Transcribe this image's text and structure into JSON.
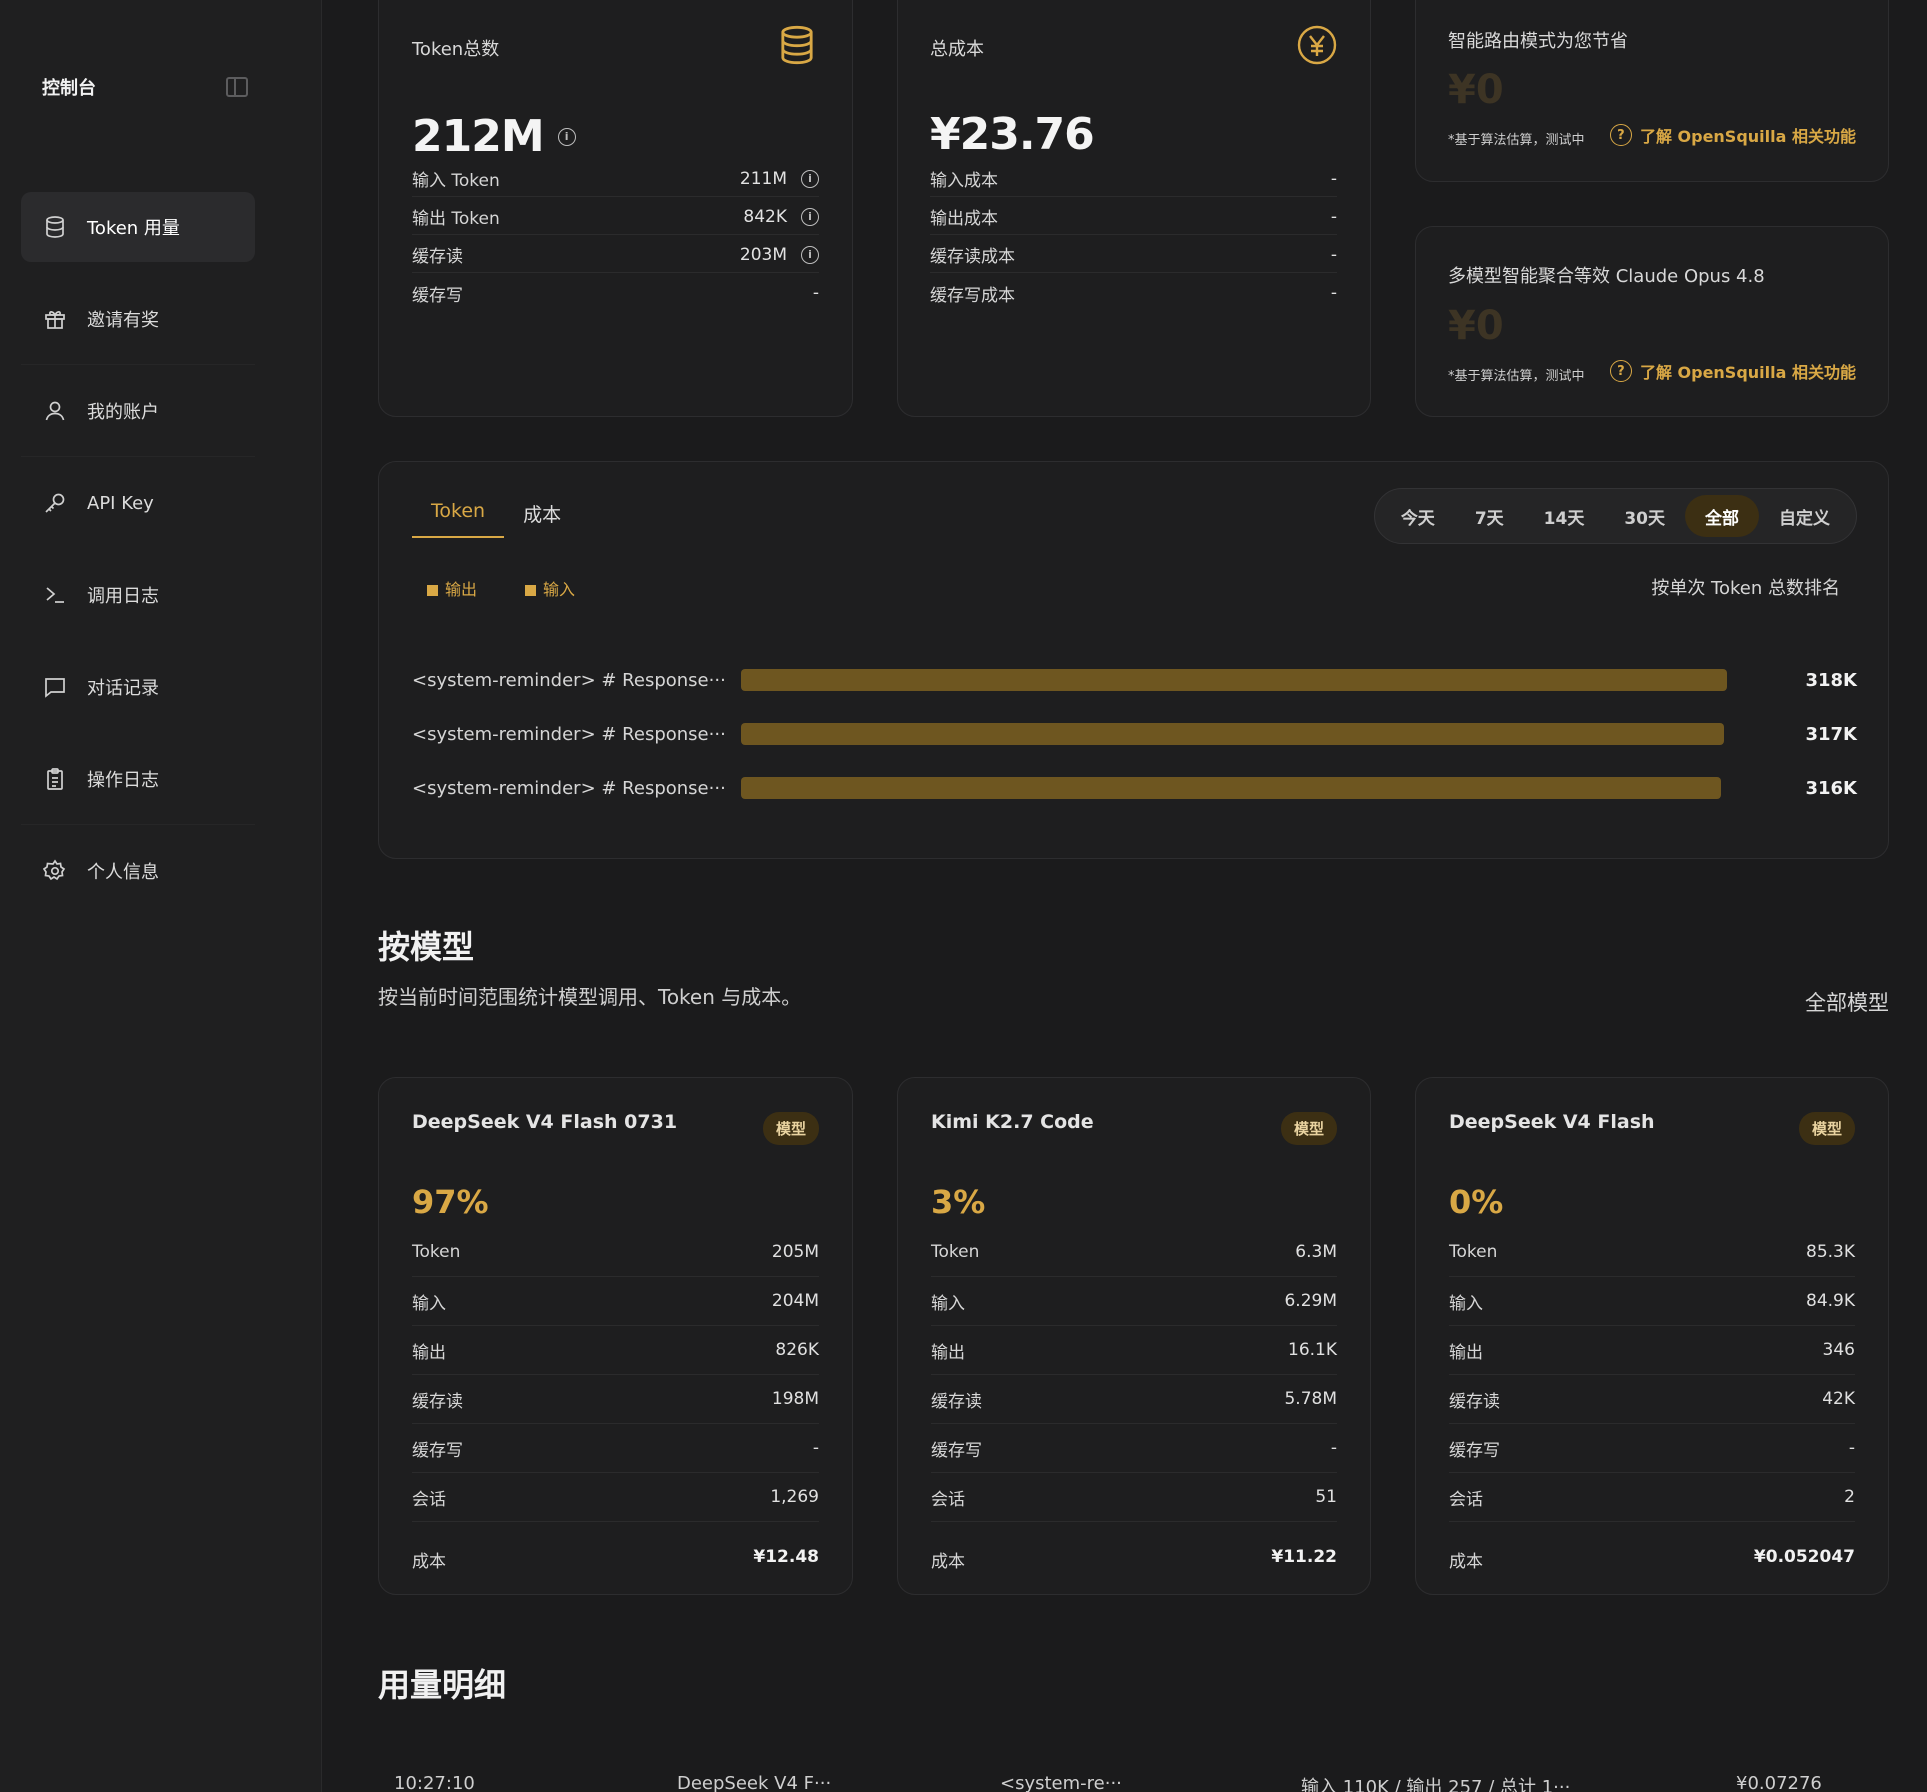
{
  "sidebar": {
    "title": "控制台",
    "items": [
      {
        "label": "Token 用量",
        "icon": "database-icon"
      },
      {
        "label": "邀请有奖",
        "icon": "gift-icon"
      },
      {
        "label": "我的账户",
        "icon": "user-icon"
      },
      {
        "label": "API Key",
        "icon": "key-icon"
      },
      {
        "label": "调用日志",
        "icon": "terminal-icon"
      },
      {
        "label": "对话记录",
        "icon": "chat-icon"
      },
      {
        "label": "操作日志",
        "icon": "clipboard-icon"
      },
      {
        "label": "个人信息",
        "icon": "gear-icon"
      }
    ]
  },
  "token_card": {
    "title": "Token总数",
    "total": "212M",
    "rows": [
      {
        "label": "输入 Token",
        "value": "211M"
      },
      {
        "label": "输出 Token",
        "value": "842K"
      },
      {
        "label": "缓存读",
        "value": "203M"
      },
      {
        "label": "缓存写",
        "value": "-"
      }
    ]
  },
  "cost_card": {
    "title": "总成本",
    "total": "¥23.76",
    "rows": [
      {
        "label": "输入成本",
        "value": "-"
      },
      {
        "label": "输出成本",
        "value": "-"
      },
      {
        "label": "缓存读成本",
        "value": "-"
      },
      {
        "label": "缓存写成本",
        "value": "-"
      }
    ]
  },
  "saving_cards": [
    {
      "title": "智能路由模式为您节省",
      "amount": "¥0",
      "note": "*基于算法估算，测试中",
      "link": "了解 OpenSquilla 相关功能"
    },
    {
      "title": "多模型智能聚合等效 Claude Opus 4.8",
      "amount": "¥0",
      "note": "*基于算法估算，测试中",
      "link": "了解 OpenSquilla 相关功能"
    }
  ],
  "chart_panel": {
    "tabs": [
      "Token",
      "成本"
    ],
    "ranges": [
      "今天",
      "7天",
      "14天",
      "30天",
      "全部",
      "自定义"
    ],
    "active_range": "全部",
    "legend": [
      "输出",
      "输入"
    ],
    "rank_hint": "按单次 Token 总数排名"
  },
  "chart_data": {
    "type": "bar",
    "orientation": "horizontal",
    "categories": [
      "<system-reminder> # Response···",
      "<system-reminder> # Response···",
      "<system-reminder> # Response···"
    ],
    "values": [
      318,
      317,
      316
    ],
    "value_labels": [
      "318K",
      "317K",
      "316K"
    ],
    "xlim": [
      0,
      318
    ],
    "color": "#6e5620"
  },
  "by_model": {
    "title": "按模型",
    "subtitle": "按当前时间范围统计模型调用、Token 与成本。",
    "filter": "全部模型",
    "badge": "模型",
    "row_labels": [
      "Token",
      "输入",
      "输出",
      "缓存读",
      "缓存写",
      "会话"
    ],
    "cost_label": "成本",
    "models": [
      {
        "name": "DeepSeek V4 Flash 0731",
        "pct": "97%",
        "values": [
          "205M",
          "204M",
          "826K",
          "198M",
          "-",
          "1,269"
        ],
        "cost": "¥12.48"
      },
      {
        "name": "Kimi K2.7 Code",
        "pct": "3%",
        "values": [
          "6.3M",
          "6.29M",
          "16.1K",
          "5.78M",
          "-",
          "51"
        ],
        "cost": "¥11.22"
      },
      {
        "name": "DeepSeek V4 Flash",
        "pct": "0%",
        "values": [
          "85.3K",
          "84.9K",
          "346",
          "42K",
          "-",
          "2"
        ],
        "cost": "¥0.052047"
      }
    ]
  },
  "usage_detail": {
    "title": "用量明细",
    "first_row": [
      "10:27:10",
      "DeepSeek V4 F···",
      "<system-re···",
      "输入 110K / 输出 257 / 总计 1···",
      "¥0.07276"
    ]
  },
  "colors": {
    "accent": "#d9a845",
    "bar": "#6e5620",
    "background": "#1b1b1c"
  }
}
